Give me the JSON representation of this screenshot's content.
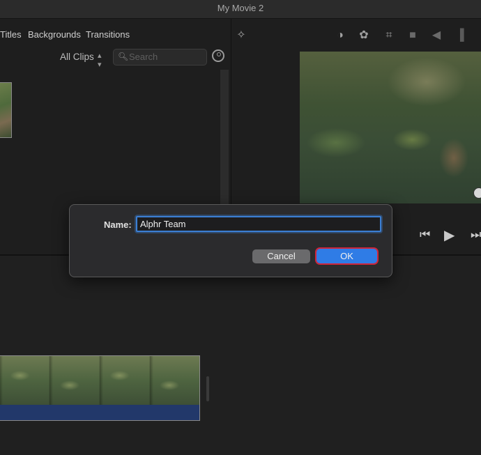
{
  "window": {
    "title": "My Movie 2"
  },
  "browser": {
    "tabs": [
      {
        "label": "Titles"
      },
      {
        "label": "Backgrounds"
      },
      {
        "label": "Transitions"
      }
    ],
    "filter_label": "All Clips",
    "search": {
      "placeholder": "Search",
      "value": ""
    }
  },
  "viewer_tools": [
    "magic-wand-icon",
    "color-balance-icon",
    "color-palette-icon",
    "crop-icon",
    "camera-icon",
    "volume-icon",
    "equalizer-icon"
  ],
  "transport": [
    "skip-back-icon",
    "play-icon",
    "skip-forward-icon"
  ],
  "dialog": {
    "name_label": "Name:",
    "name_value": "Alphr Team",
    "cancel_label": "Cancel",
    "ok_label": "OK"
  },
  "colors": {
    "accent": "#2f7ce6",
    "highlight_ring": "#d0253a",
    "focus_ring": "#3b7fd4"
  }
}
